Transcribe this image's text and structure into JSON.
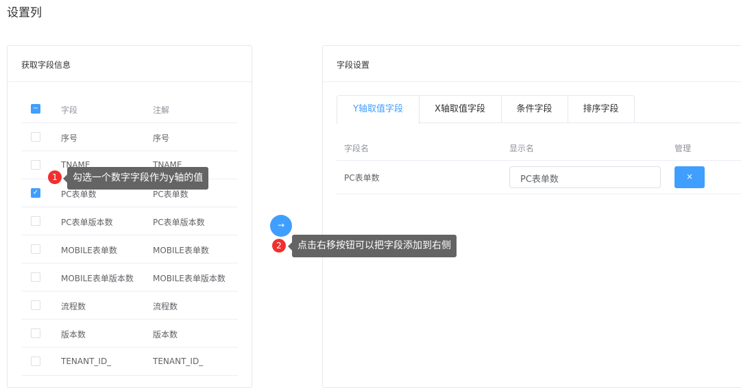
{
  "title": "设置列",
  "left": {
    "header": "获取字段信息",
    "columns": [
      "字段",
      "注解"
    ],
    "rows": [
      {
        "field": "序号",
        "note": "序号",
        "checked": false
      },
      {
        "field": "TNAME",
        "note": "TNAME",
        "checked": false
      },
      {
        "field": "PC表单数",
        "note": "PC表单数",
        "checked": true
      },
      {
        "field": "PC表单版本数",
        "note": "PC表单版本数",
        "checked": false
      },
      {
        "field": "MOBILE表单数",
        "note": "MOBILE表单数",
        "checked": false
      },
      {
        "field": "MOBILE表单版本数",
        "note": "MOBILE表单版本数",
        "checked": false
      },
      {
        "field": "流程数",
        "note": "流程数",
        "checked": false
      },
      {
        "field": "版本数",
        "note": "版本数",
        "checked": false
      },
      {
        "field": "TENANT_ID_",
        "note": "TENANT_ID_",
        "checked": false
      }
    ]
  },
  "right": {
    "header": "字段设置",
    "tabs": [
      "Y轴取值字段",
      "X轴取值字段",
      "条件字段",
      "排序字段"
    ],
    "active_tab": 0,
    "columns": [
      "字段名",
      "显示名",
      "管理"
    ],
    "rows": [
      {
        "field": "PC表单数",
        "display": "PC表单数",
        "delete": "×"
      }
    ]
  },
  "transfer_button": "→",
  "tips": [
    {
      "num": "1",
      "text": "勾选一个数字字段作为y轴的值"
    },
    {
      "num": "2",
      "text": "点击右移按钮可以把字段添加到右侧"
    }
  ],
  "colors": {
    "primary": "#409eff",
    "badge": "#f03030"
  }
}
